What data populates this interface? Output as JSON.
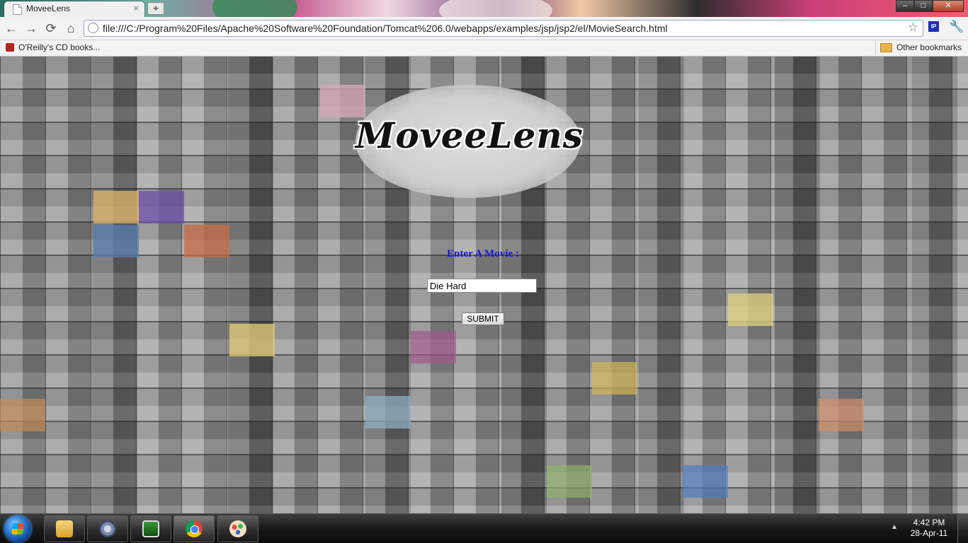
{
  "browser": {
    "tab_title": "MoveeLens",
    "new_tab_label": "+",
    "url": "file:///C:/Program%20Files/Apache%20Software%20Foundation/Tomcat%206.0/webapps/examples/jsp/jsp2/el/MovieSearch.html",
    "window_buttons": {
      "minimize": "–",
      "maximize": "□",
      "close": "✕"
    },
    "icons": {
      "back": "←",
      "forward": "→",
      "reload": "⟳",
      "home": "⌂",
      "star": "☆",
      "wrench": "🔧",
      "ip": "IP"
    }
  },
  "bookmarks": {
    "items": [
      {
        "label": "O'Reilly's CD books..."
      }
    ],
    "other_label": "Other bookmarks"
  },
  "page": {
    "logo_text": "MoveeLens",
    "prompt_label": "Enter A Movie :",
    "search": {
      "value": "Die Hard"
    },
    "submit_label": "SUBMIT",
    "accent_color": "#1515d8"
  },
  "taskbar": {
    "apps": [
      {
        "name": "windows-explorer"
      },
      {
        "name": "control-panel"
      },
      {
        "name": "task-manager"
      },
      {
        "name": "google-chrome"
      },
      {
        "name": "paint"
      }
    ],
    "time": "4:42 PM",
    "date": "28-Apr-11"
  }
}
